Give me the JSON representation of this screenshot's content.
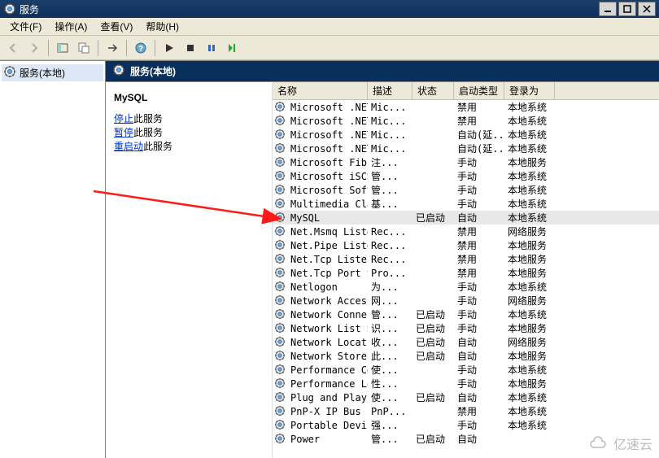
{
  "window": {
    "title": "服务",
    "icon": "gear-icon"
  },
  "menu": {
    "file": "文件(F)",
    "action": "操作(A)",
    "view": "查看(V)",
    "help": "帮助(H)"
  },
  "tree": {
    "root": "服务(本地)"
  },
  "content_header": "服务(本地)",
  "task_panel": {
    "selected": "MySQL",
    "links": {
      "stop": "停止",
      "stop_suffix": "此服务",
      "pause": "暂停",
      "pause_suffix": "此服务",
      "restart": "重启动",
      "restart_suffix": "此服务"
    }
  },
  "columns": {
    "name": "名称",
    "desc": "描述",
    "status": "状态",
    "startup": "启动类型",
    "logon": "登录为"
  },
  "rows": [
    {
      "name": "Microsoft .NET...",
      "desc": "Mic...",
      "status": "",
      "startup": "禁用",
      "logon": "本地系统"
    },
    {
      "name": "Microsoft .NET...",
      "desc": "Mic...",
      "status": "",
      "startup": "禁用",
      "logon": "本地系统"
    },
    {
      "name": "Microsoft .NET...",
      "desc": "Mic...",
      "status": "",
      "startup": "自动(延...",
      "logon": "本地系统"
    },
    {
      "name": "Microsoft .NET...",
      "desc": "Mic...",
      "status": "",
      "startup": "自动(延...",
      "logon": "本地系统"
    },
    {
      "name": "Microsoft Fibr...",
      "desc": "注...",
      "status": "",
      "startup": "手动",
      "logon": "本地服务"
    },
    {
      "name": "Microsoft iSCS...",
      "desc": "管...",
      "status": "",
      "startup": "手动",
      "logon": "本地系统"
    },
    {
      "name": "Microsoft Soft...",
      "desc": "管...",
      "status": "",
      "startup": "手动",
      "logon": "本地系统"
    },
    {
      "name": "Multimedia Cla...",
      "desc": "基...",
      "status": "",
      "startup": "手动",
      "logon": "本地系统"
    },
    {
      "name": "MySQL",
      "desc": "",
      "status": "已启动",
      "startup": "自动",
      "logon": "本地系统",
      "selected": true
    },
    {
      "name": "Net.Msmq Liste...",
      "desc": "Rec...",
      "status": "",
      "startup": "禁用",
      "logon": "网络服务"
    },
    {
      "name": "Net.Pipe Liste...",
      "desc": "Rec...",
      "status": "",
      "startup": "禁用",
      "logon": "本地服务"
    },
    {
      "name": "Net.Tcp Listen...",
      "desc": "Rec...",
      "status": "",
      "startup": "禁用",
      "logon": "本地服务"
    },
    {
      "name": "Net.Tcp Port S...",
      "desc": "Pro...",
      "status": "",
      "startup": "禁用",
      "logon": "本地服务"
    },
    {
      "name": "Netlogon",
      "desc": "为...",
      "status": "",
      "startup": "手动",
      "logon": "本地系统"
    },
    {
      "name": "Network Access...",
      "desc": "网...",
      "status": "",
      "startup": "手动",
      "logon": "网络服务"
    },
    {
      "name": "Network Connec...",
      "desc": "管...",
      "status": "已启动",
      "startup": "手动",
      "logon": "本地系统"
    },
    {
      "name": "Network List S...",
      "desc": "识...",
      "status": "已启动",
      "startup": "手动",
      "logon": "本地服务"
    },
    {
      "name": "Network Locati...",
      "desc": "收...",
      "status": "已启动",
      "startup": "自动",
      "logon": "网络服务"
    },
    {
      "name": "Network Store ...",
      "desc": "此...",
      "status": "已启动",
      "startup": "自动",
      "logon": "本地服务"
    },
    {
      "name": "Performance Co...",
      "desc": "使...",
      "status": "",
      "startup": "手动",
      "logon": "本地系统"
    },
    {
      "name": "Performance Lo...",
      "desc": "性...",
      "status": "",
      "startup": "手动",
      "logon": "本地服务"
    },
    {
      "name": "Plug and Play",
      "desc": "使...",
      "status": "已启动",
      "startup": "自动",
      "logon": "本地系统"
    },
    {
      "name": "PnP-X IP Bus E...",
      "desc": "PnP...",
      "status": "",
      "startup": "禁用",
      "logon": "本地系统"
    },
    {
      "name": "Portable Devic...",
      "desc": "强...",
      "status": "",
      "startup": "手动",
      "logon": "本地系统"
    },
    {
      "name": "Power",
      "desc": "管...",
      "status": "已启动",
      "startup": "自动",
      "logon": ""
    }
  ],
  "watermark": "亿速云"
}
